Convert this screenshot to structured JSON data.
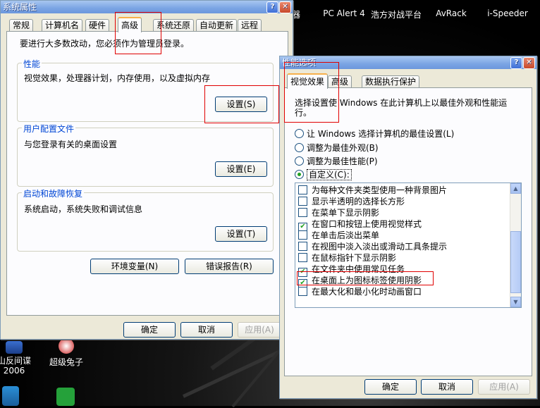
{
  "desktop": {
    "icons_top": [
      {
        "label": "器"
      },
      {
        "label": "PC Alert 4"
      },
      {
        "label": "浩方对战平台"
      },
      {
        "label": "AvRack"
      },
      {
        "label": "i-Speeder"
      }
    ],
    "icons_bottom": [
      {
        "label": "山反间谍\n2006"
      },
      {
        "label": "超级兔子"
      }
    ]
  },
  "sysprops": {
    "title": "系统属性",
    "tabs": [
      "常规",
      "计算机名",
      "硬件",
      "高级",
      "系统还原",
      "自动更新",
      "远程"
    ],
    "admin_note": "要进行大多数改动，您必须作为管理员登录。",
    "performance": {
      "legend": "性能",
      "desc": "视觉效果，处理器计划，内存使用，以及虚拟内存",
      "button": "设置(S)"
    },
    "profile": {
      "legend": "用户配置文件",
      "desc": "与您登录有关的桌面设置",
      "button": "设置(E)"
    },
    "startup": {
      "legend": "启动和故障恢复",
      "desc": "系统启动，系统失败和调试信息",
      "button": "设置(T)"
    },
    "env_button": "环境变量(N)",
    "error_button": "错误报告(R)",
    "ok": "确定",
    "cancel": "取消",
    "apply": "应用(A)"
  },
  "perfopts": {
    "title": "性能选项",
    "tabs": [
      "视觉效果",
      "高级",
      "数据执行保护"
    ],
    "desc_line1": "选择设置使 Windows 在此计算机上以最佳外观和性能运",
    "desc_line2": "行。",
    "radios": [
      {
        "label": "让 Windows 选择计算机的最佳设置(L)",
        "selected": false
      },
      {
        "label": "调整为最佳外观(B)",
        "selected": false
      },
      {
        "label": "调整为最佳性能(P)",
        "selected": false
      },
      {
        "label": "自定义(C):",
        "selected": true
      }
    ],
    "options": [
      {
        "label": "为每种文件夹类型使用一种背景图片",
        "checked": false
      },
      {
        "label": "显示半透明的选择长方形",
        "checked": false
      },
      {
        "label": "在菜单下显示阴影",
        "checked": false
      },
      {
        "label": "在窗口和按钮上使用视觉样式",
        "checked": true
      },
      {
        "label": "在单击后淡出菜单",
        "checked": false
      },
      {
        "label": "在视图中淡入淡出或滑动工具条提示",
        "checked": false
      },
      {
        "label": "在鼠标指针下显示阴影",
        "checked": false
      },
      {
        "label": "在文件夹中使用常见任务",
        "checked": true
      },
      {
        "label": "在桌面上为图标标签使用阴影",
        "checked": true
      },
      {
        "label": "在最大化和最小化时动画窗口",
        "checked": false
      }
    ],
    "ok": "确定",
    "cancel": "取消",
    "apply": "应用(A)"
  },
  "colors": {
    "highlight_box": "#e00000",
    "title_text": "#ffffff",
    "group_legend": "#0046d5"
  }
}
